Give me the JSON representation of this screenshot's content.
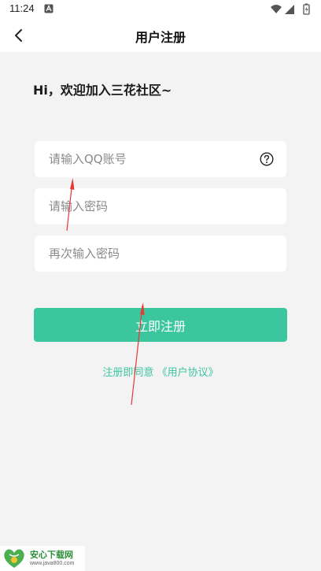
{
  "status_bar": {
    "time": "11:24"
  },
  "nav": {
    "title": "用户注册"
  },
  "greeting": "Hi，欢迎加入三花社区~",
  "form": {
    "qq_placeholder": "请输入QQ账号",
    "password_placeholder": "请输入密码",
    "confirm_placeholder": "再次输入密码",
    "register_label": "立即注册"
  },
  "agreement": {
    "prefix": "注册即同意",
    "link": "《用户协议》"
  },
  "watermark": {
    "title": "安心下载网",
    "url": "www.java800.com"
  },
  "colors": {
    "accent": "#3cc6a0",
    "background": "#f3f3f3",
    "arrow": "#e53935"
  }
}
